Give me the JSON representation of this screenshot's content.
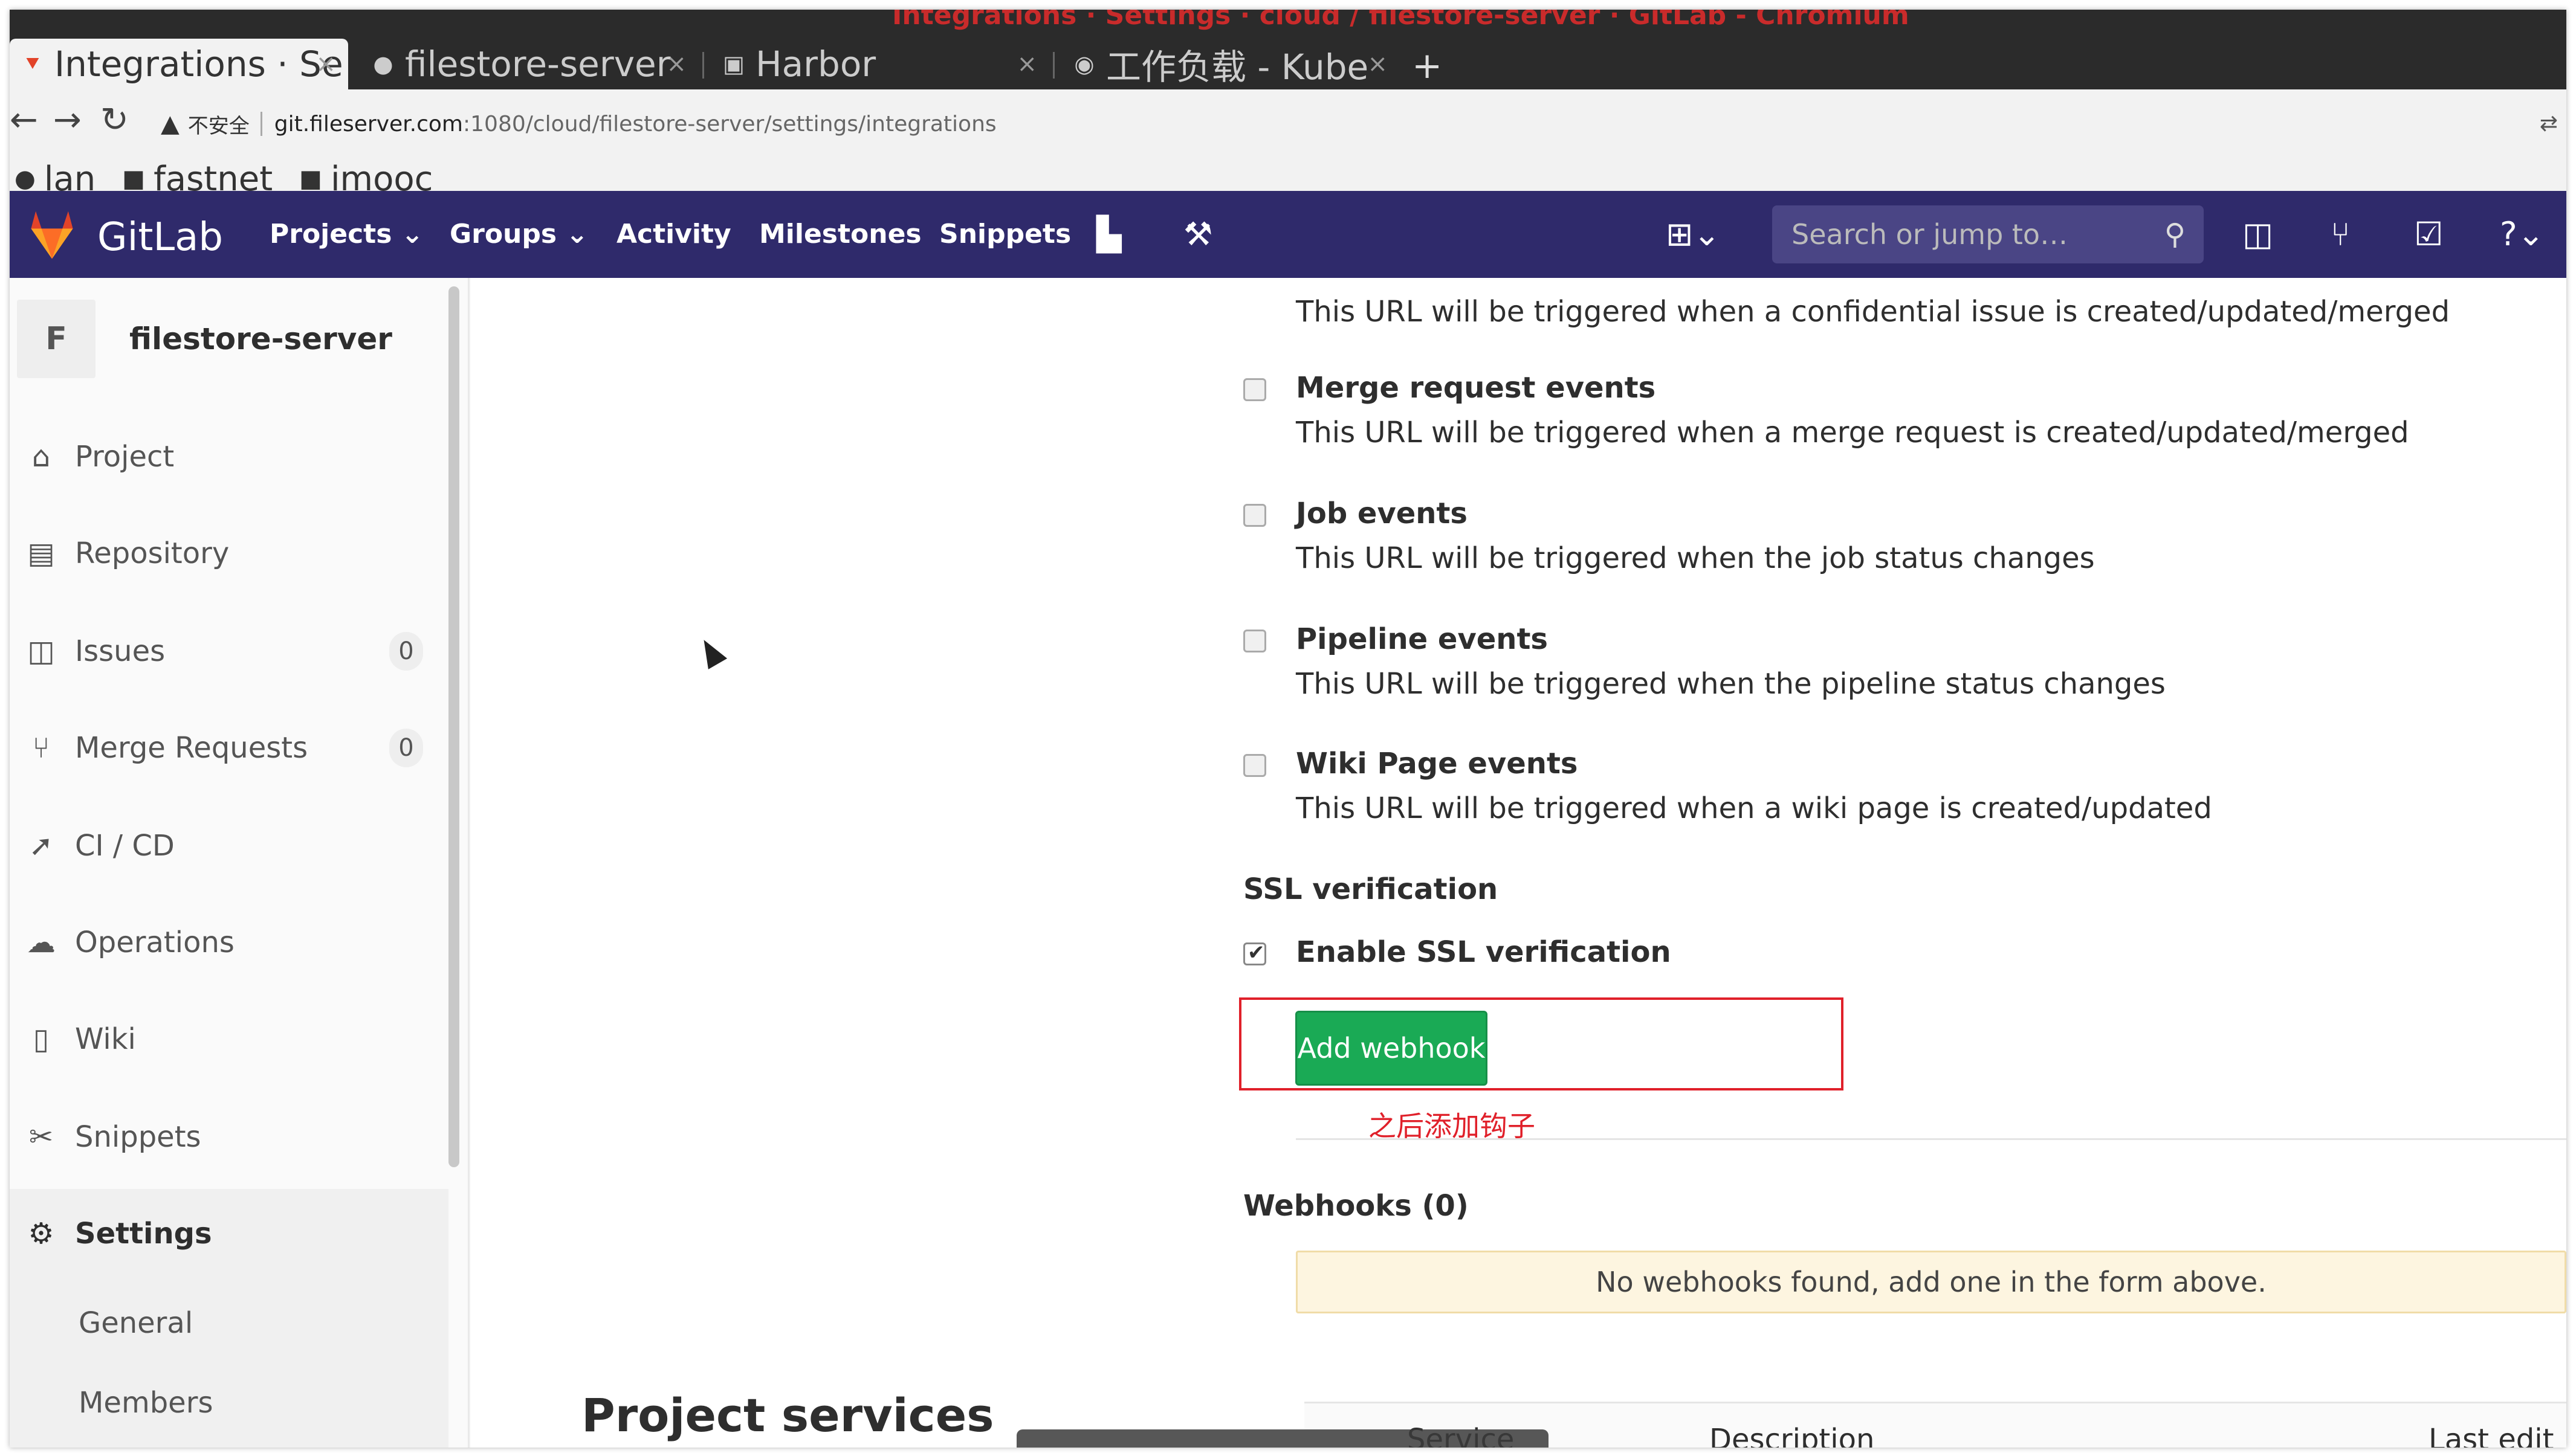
{
  "window_title": "Integrations · Settings · cloud / filestore-server · GitLab - Chromium",
  "tabs": [
    {
      "label": "Integrations · Se",
      "active": true
    },
    {
      "label": "filestore-server",
      "active": false
    },
    {
      "label": "Harbor",
      "active": false
    },
    {
      "label": "工作负载 - Kube",
      "active": false
    }
  ],
  "address": {
    "insecure_label": "不安全",
    "url_host": "git.fileserver.com",
    "url_path": ":1080/cloud/filestore-server/settings/integrations"
  },
  "bookmarks": [
    {
      "label": "lan",
      "icon": "github-icon"
    },
    {
      "label": "fastnet",
      "icon": "folder-icon"
    },
    {
      "label": "imooc",
      "icon": "folder-icon"
    }
  ],
  "header": {
    "brand": "GitLab",
    "nav": [
      "Projects",
      "Groups",
      "Activity",
      "Milestones",
      "Snippets"
    ],
    "search_placeholder": "Search or jump to…"
  },
  "sidebar": {
    "avatar_letter": "F",
    "project_name": "filestore-server",
    "items": [
      {
        "label": "Project",
        "icon": "home-icon"
      },
      {
        "label": "Repository",
        "icon": "doc-icon"
      },
      {
        "label": "Issues",
        "icon": "issues-icon",
        "count": "0"
      },
      {
        "label": "Merge Requests",
        "icon": "merge-icon",
        "count": "0"
      },
      {
        "label": "CI / CD",
        "icon": "rocket-icon"
      },
      {
        "label": "Operations",
        "icon": "cloud-gear-icon"
      },
      {
        "label": "Wiki",
        "icon": "book-icon"
      },
      {
        "label": "Snippets",
        "icon": "scissors-icon"
      },
      {
        "label": "Settings",
        "icon": "gear-icon"
      }
    ],
    "settings_sub": [
      "General",
      "Members"
    ]
  },
  "main": {
    "confidential_desc": "This URL will be triggered when a confidential issue is created/updated/merged",
    "events": [
      {
        "title": "Merge request events",
        "desc": "This URL will be triggered when a merge request is created/updated/merged",
        "checked": false
      },
      {
        "title": "Job events",
        "desc": "This URL will be triggered when the job status changes",
        "checked": false
      },
      {
        "title": "Pipeline events",
        "desc": "This URL will be triggered when the pipeline status changes",
        "checked": false
      },
      {
        "title": "Wiki Page events",
        "desc": "This URL will be triggered when a wiki page is created/updated",
        "checked": false
      }
    ],
    "ssl_title": "SSL verification",
    "ssl_label": "Enable SSL verification",
    "ssl_checked": true,
    "add_button": "Add webhook",
    "annotation": "之后添加钩子",
    "webhooks_title": "Webhooks (0)",
    "empty_msg": "No webhooks found, add one in the form above.",
    "services_title": "Project services",
    "table_headers": [
      "Service",
      "Description",
      "Last edit"
    ]
  },
  "colors": {
    "header_bg": "#2f2a6b",
    "add_button": "#1aaa55",
    "annotation_red": "#e0202a"
  }
}
